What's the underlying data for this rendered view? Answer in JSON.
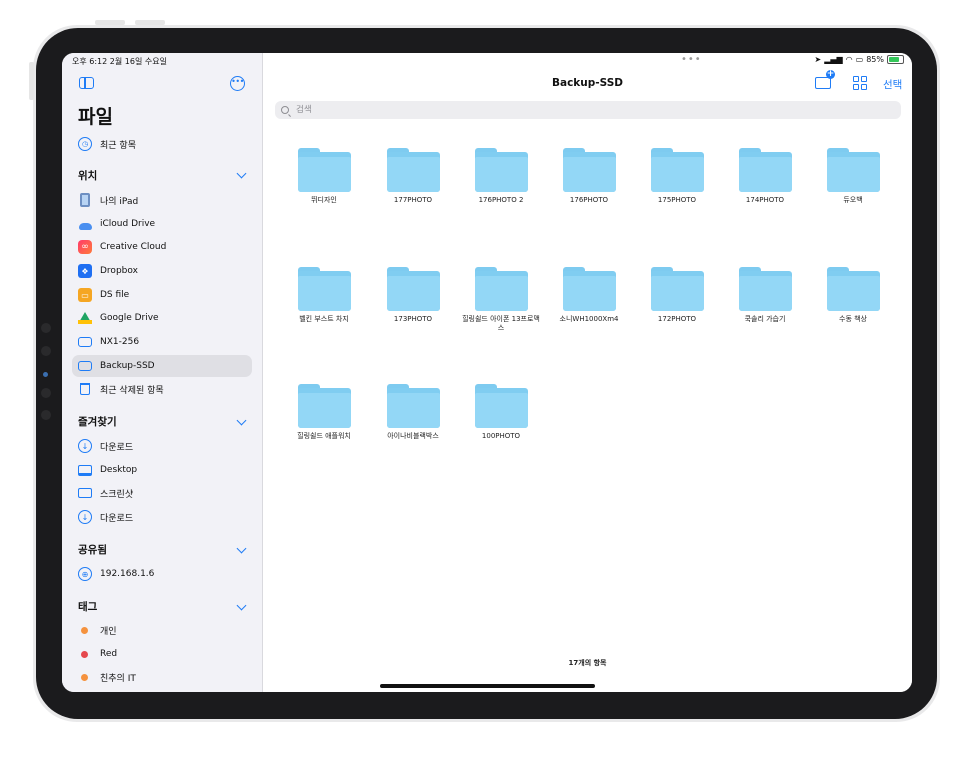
{
  "status": {
    "time_date": "오후 6:12  2월 16일 수요일",
    "battery": "85%"
  },
  "sidebar": {
    "title": "파일",
    "recent": "최근 항목",
    "sections": {
      "locations": {
        "header": "위치",
        "items": [
          {
            "label": "나의 iPad",
            "icon": "ipad-icon"
          },
          {
            "label": "iCloud Drive",
            "icon": "icloud-icon"
          },
          {
            "label": "Creative Cloud",
            "icon": "creative-cloud-icon"
          },
          {
            "label": "Dropbox",
            "icon": "dropbox-icon"
          },
          {
            "label": "DS file",
            "icon": "ds-file-icon"
          },
          {
            "label": "Google Drive",
            "icon": "google-drive-icon"
          },
          {
            "label": "NX1-256",
            "icon": "drive-icon"
          },
          {
            "label": "Backup-SSD",
            "icon": "drive-icon",
            "selected": true
          },
          {
            "label": "최근 삭제된 항목",
            "icon": "trash-icon"
          }
        ]
      },
      "favorites": {
        "header": "즐겨찾기",
        "items": [
          {
            "label": "다운로드",
            "icon": "download-icon"
          },
          {
            "label": "Desktop",
            "icon": "desktop-icon"
          },
          {
            "label": "스크린샷",
            "icon": "folder-icon"
          },
          {
            "label": "다운로드",
            "icon": "download-icon"
          }
        ]
      },
      "shared": {
        "header": "공유됨",
        "items": [
          {
            "label": "192.168.1.6",
            "icon": "globe-icon"
          }
        ]
      },
      "tags": {
        "header": "태그",
        "items": [
          {
            "label": "개인",
            "color": "#f5923e"
          },
          {
            "label": "Red",
            "color": "#e5484d"
          },
          {
            "label": "친추의 IT",
            "color": "#f5923e"
          }
        ]
      }
    }
  },
  "main": {
    "title": "Backup-SSD",
    "select_label": "선택",
    "search_placeholder": "검색",
    "folders": [
      "뛰디자인",
      "177PHOTO",
      "176PHOTO 2",
      "176PHOTO",
      "175PHOTO",
      "174PHOTO",
      "듀오백",
      "벨킨 부스트 차지",
      "173PHOTO",
      "힐링쉴드 아이폰 13프로맥스",
      "소니WH1000Xm4",
      "172PHOTO",
      "쿡솔리 가습기",
      "수동 책상",
      "힐링쉴드 애플워치",
      "아이나비블랙박스",
      "100PHOTO"
    ],
    "item_count": "17개의 항목"
  },
  "colors": {
    "accent": "#1f7cf6",
    "folder": "#93d7f6"
  }
}
